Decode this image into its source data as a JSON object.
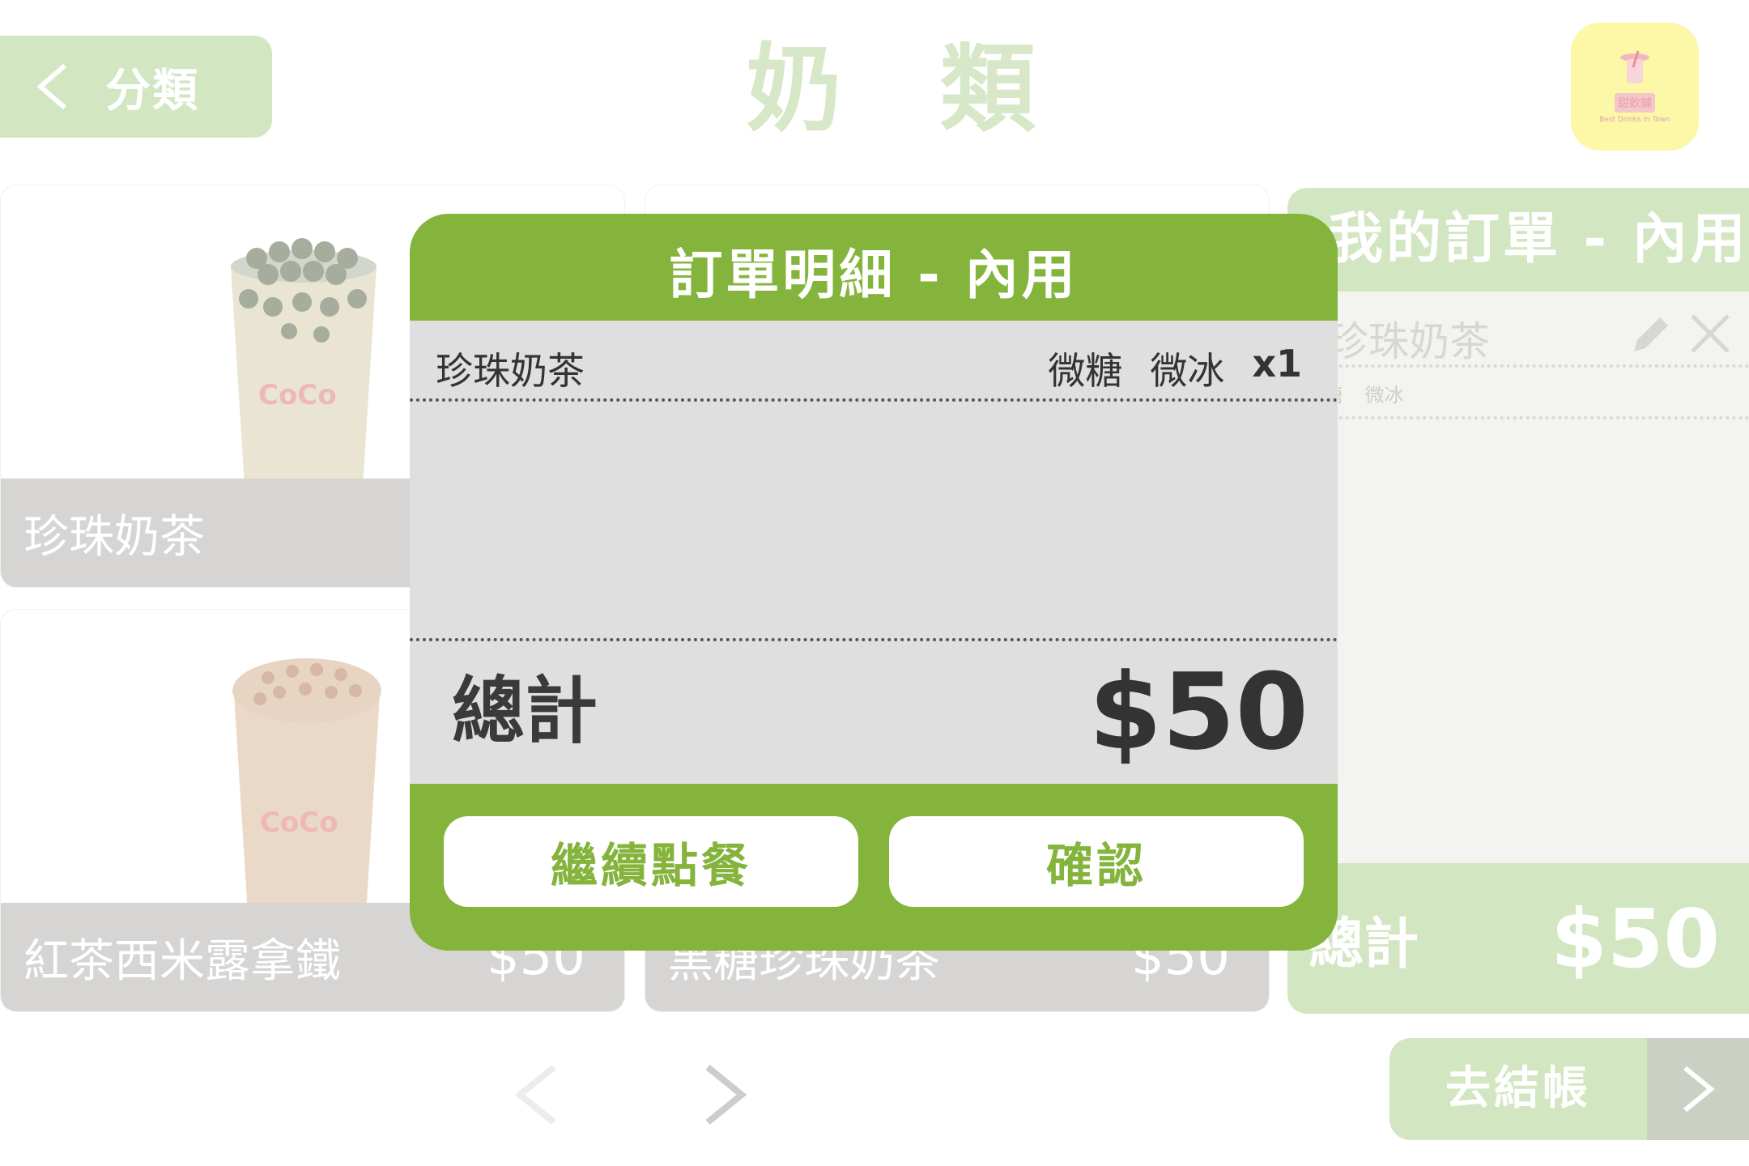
{
  "header": {
    "back_label": "分類",
    "title": "奶 類",
    "logo_brand": "甜飲鋪",
    "logo_tagline": "Best Drinks in Town"
  },
  "products": [
    {
      "name": "珍珠奶茶",
      "price": ""
    },
    {
      "name": "",
      "price": ""
    },
    {
      "name": "紅茶西米露拿鐵",
      "price": "$50"
    },
    {
      "name": "黑糖珍珠奶茶",
      "price": "$50"
    }
  ],
  "cup_brand": "CoCo",
  "order_panel": {
    "title": "我的訂單 - 內用",
    "item_name": "珍珠奶茶",
    "item_options": "糖 微冰",
    "total_label": "總計",
    "total_value": "$50"
  },
  "checkout": {
    "label": "去結帳"
  },
  "modal": {
    "title": "訂單明細 - 內用",
    "items": [
      {
        "name": "珍珠奶茶",
        "sugar": "微糖",
        "ice": "微冰",
        "qty": "x1"
      }
    ],
    "total_label": "總計",
    "total_value": "$50",
    "continue_label": "繼續點餐",
    "confirm_label": "確認"
  },
  "colors": {
    "modal_green": "#84b43c",
    "light_green": "#d3e6c2",
    "modal_body": "#dfdfdf"
  }
}
